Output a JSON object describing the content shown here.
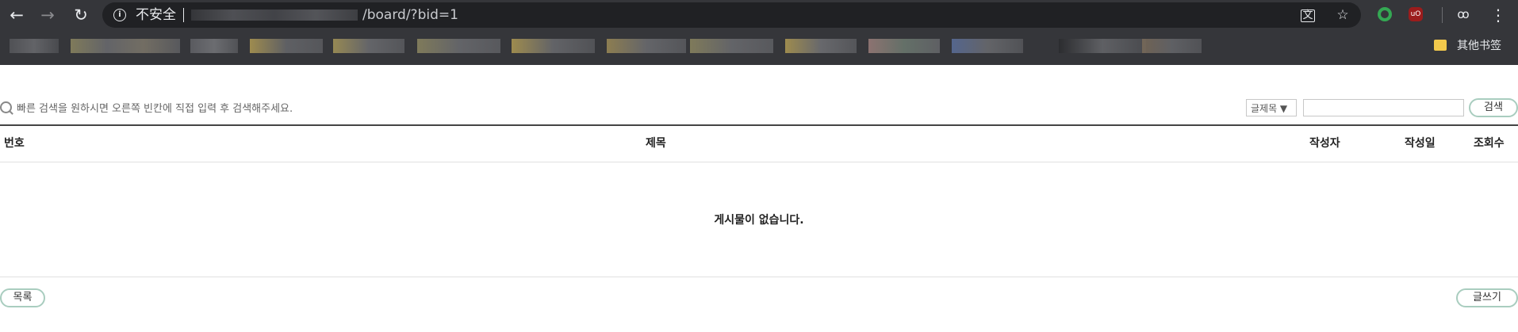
{
  "browser": {
    "security_label": "不安全",
    "url_path": "/board/?bid=1",
    "bookmarks_other_label": "其他书签",
    "back_icon": "arrow-left-icon",
    "forward_icon": "arrow-right-icon",
    "reload_icon": "reload-icon"
  },
  "board": {
    "search_hint": "빠른 검색을 원하시면 오른쪽 빈칸에 직접 입력 후 검색해주세요.",
    "search_field_select": "글제목 ▼",
    "search_button": "검색",
    "columns": [
      "번호",
      "제목",
      "작성자",
      "작성일",
      "조회수"
    ],
    "empty_message": "게시물이 없습니다.",
    "list_button": "목록",
    "write_button": "글쓰기"
  },
  "colors": {
    "chrome_bg": "#35363a",
    "omnibox_bg": "#202124",
    "button_border": "#a9cdbf"
  }
}
